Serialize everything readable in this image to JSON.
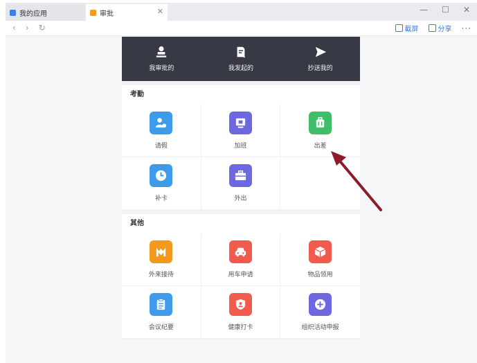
{
  "tabs": [
    {
      "label": "我的应用"
    },
    {
      "label": "审批"
    }
  ],
  "toolbar": {
    "screenshot": "截屏",
    "share": "分享",
    "more": "···"
  },
  "header": {
    "items": [
      {
        "label": "我审批的"
      },
      {
        "label": "我发起的"
      },
      {
        "label": "抄送我的"
      }
    ]
  },
  "attendance": {
    "title": "考勤",
    "items": [
      {
        "label": "请假",
        "color": "#3d9be9"
      },
      {
        "label": "加班",
        "color": "#6e68e0"
      },
      {
        "label": "出差",
        "color": "#3fbe6a"
      },
      {
        "label": "补卡",
        "color": "#3d9be9"
      },
      {
        "label": "外出",
        "color": "#6e68e0"
      }
    ]
  },
  "other": {
    "title": "其他",
    "items": [
      {
        "label": "外来接待",
        "color": "#f39a1e"
      },
      {
        "label": "用车申请",
        "color": "#f05b4e"
      },
      {
        "label": "物品领用",
        "color": "#f05b4e"
      },
      {
        "label": "会议纪要",
        "color": "#3d9be9"
      },
      {
        "label": "健康打卡",
        "color": "#f05b4e"
      },
      {
        "label": "组织活动申报",
        "color": "#6e68e0"
      }
    ]
  }
}
